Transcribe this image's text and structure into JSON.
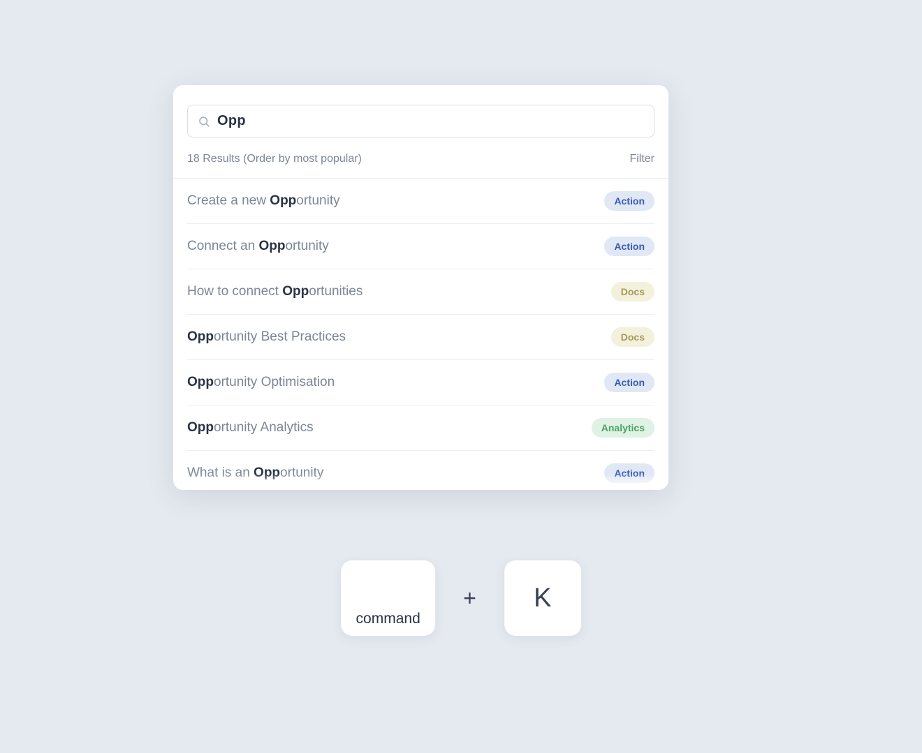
{
  "search": {
    "query": "Opp",
    "placeholder": ""
  },
  "meta": {
    "results_text": "18 Results (Order by most popular)",
    "filter_label": "Filter"
  },
  "tags": {
    "action": "Action",
    "docs": "Docs",
    "analytics": "Analytics"
  },
  "results": [
    {
      "pre": "Create a new ",
      "match": "Opp",
      "post": "ortunity",
      "tag": "action"
    },
    {
      "pre": "Connect an ",
      "match": "Opp",
      "post": "ortunity",
      "tag": "action"
    },
    {
      "pre": "How to connect ",
      "match": "Opp",
      "post": "ortunities",
      "tag": "docs"
    },
    {
      "pre": "",
      "match": "Opp",
      "post": "ortunity Best Practices",
      "tag": "docs"
    },
    {
      "pre": "",
      "match": "Opp",
      "post": "ortunity Optimisation",
      "tag": "action"
    },
    {
      "pre": "",
      "match": "Opp",
      "post": "ortunity Analytics",
      "tag": "analytics"
    },
    {
      "pre": "What is an ",
      "match": "Opp",
      "post": "ortunity",
      "tag": "action"
    }
  ],
  "shortcut": {
    "key1": "command",
    "sep": "+",
    "key2": "K"
  }
}
